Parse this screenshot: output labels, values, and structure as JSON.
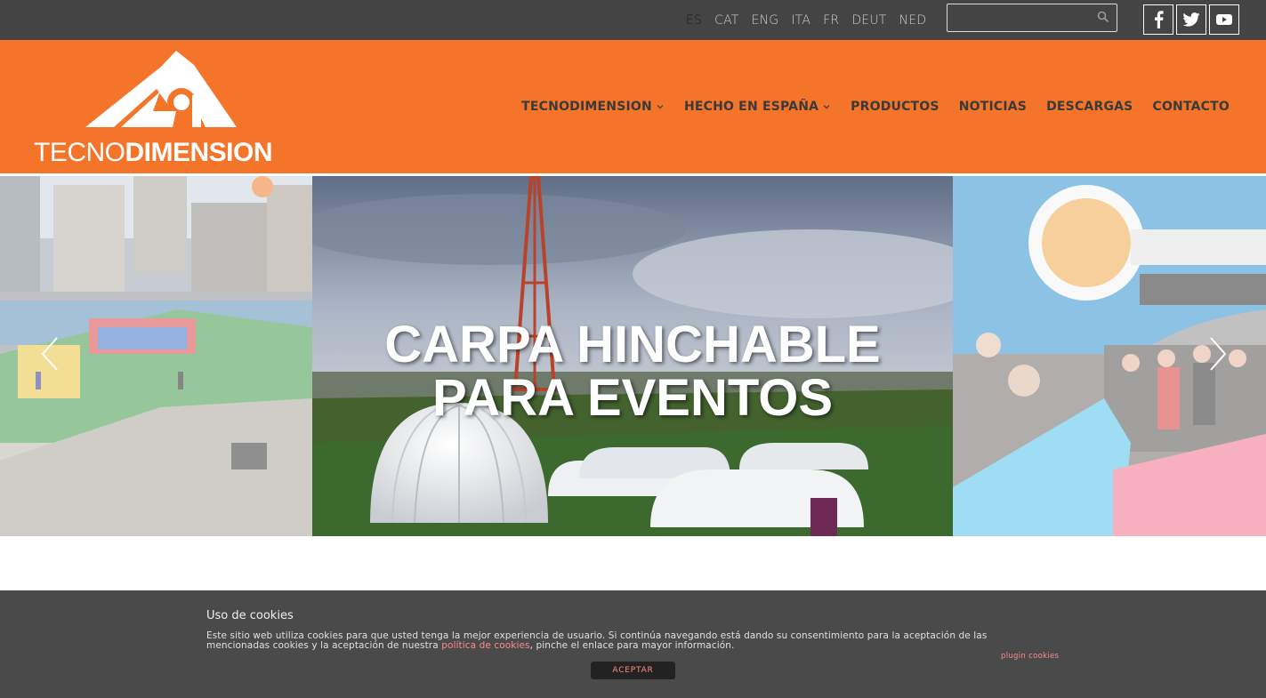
{
  "topbar": {
    "languages": [
      {
        "label": "ES",
        "active": true
      },
      {
        "label": "CAT"
      },
      {
        "label": "ENG"
      },
      {
        "label": "ITA"
      },
      {
        "label": "FR"
      },
      {
        "label": "DEUT"
      },
      {
        "label": "NED"
      }
    ],
    "search": {
      "value": "",
      "placeholder": ""
    },
    "social": [
      "facebook-icon",
      "twitter-icon",
      "youtube-icon"
    ]
  },
  "header": {
    "logo_light": "TECNO",
    "logo_bold": "DIMENSION",
    "nav": [
      {
        "label": "TECNODIMENSION",
        "dropdown": true
      },
      {
        "label": "HECHO EN ESPAÑA",
        "dropdown": true
      },
      {
        "label": "PRODUCTOS"
      },
      {
        "label": "NOTICIAS"
      },
      {
        "label": "DESCARGAS"
      },
      {
        "label": "CONTACTO"
      }
    ]
  },
  "slider": {
    "title_line1": "CARPA HINCHABLE",
    "title_line2": "PARA EVENTOS",
    "prev_icon": "chevron-left-icon",
    "next_icon": "chevron-right-icon"
  },
  "cookie": {
    "title": "Uso de cookies",
    "text_before": "Este sitio web utiliza cookies para que usted tenga la mejor experiencia de usuario. Si continúa navegando está dando su consentimiento para la aceptación de las mencionadas cookies y la aceptación de nuestra ",
    "link_label": "política de cookies",
    "text_after": ", pinche el enlace para mayor información.",
    "plugin_label": "plugin cookies",
    "accept_label": "ACEPTAR"
  },
  "colors": {
    "brand_orange": "#f4742a",
    "topbar": "#444444",
    "cookie_bg": "#4a4a4a",
    "link": "#ff8a8a"
  }
}
